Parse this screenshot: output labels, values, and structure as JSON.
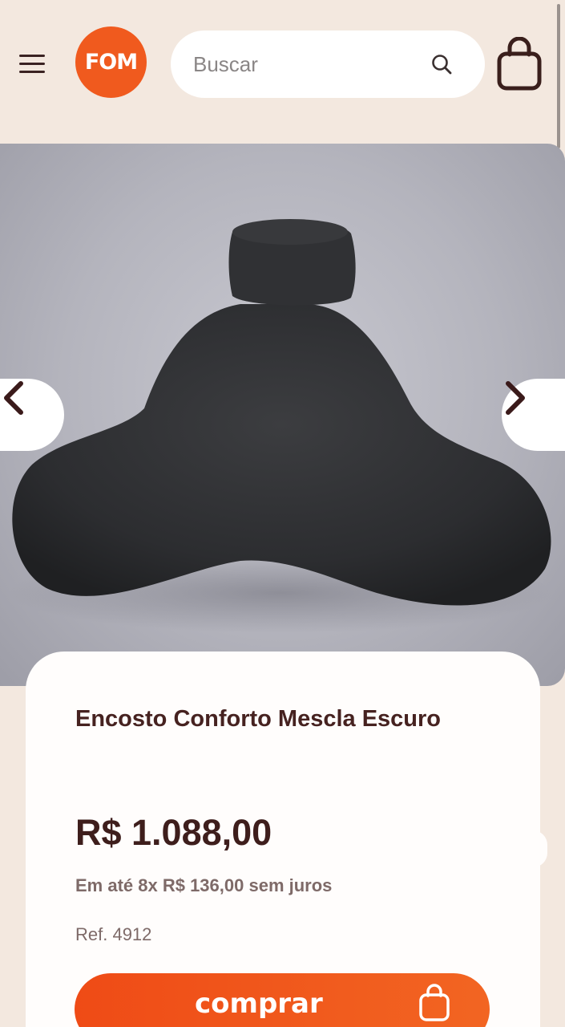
{
  "header": {
    "logo_text": "FOM",
    "search": {
      "placeholder": "Buscar",
      "value": ""
    }
  },
  "icons": {
    "menu": "hamburger-icon",
    "search": "search-icon",
    "bag": "shopping-bag-icon",
    "prev": "chevron-left-icon",
    "next": "chevron-right-icon"
  },
  "product": {
    "title": "Encosto Conforto Mescla Escuro",
    "price": "R$ 1.088,00",
    "installments": "Em até 8x R$ 136,00 sem juros",
    "reference": "Ref. 4912",
    "buy_label": "comprar"
  },
  "colors": {
    "brand_orange": "#f05a1e",
    "text_dark": "#462220",
    "background": "#f3e8df"
  }
}
